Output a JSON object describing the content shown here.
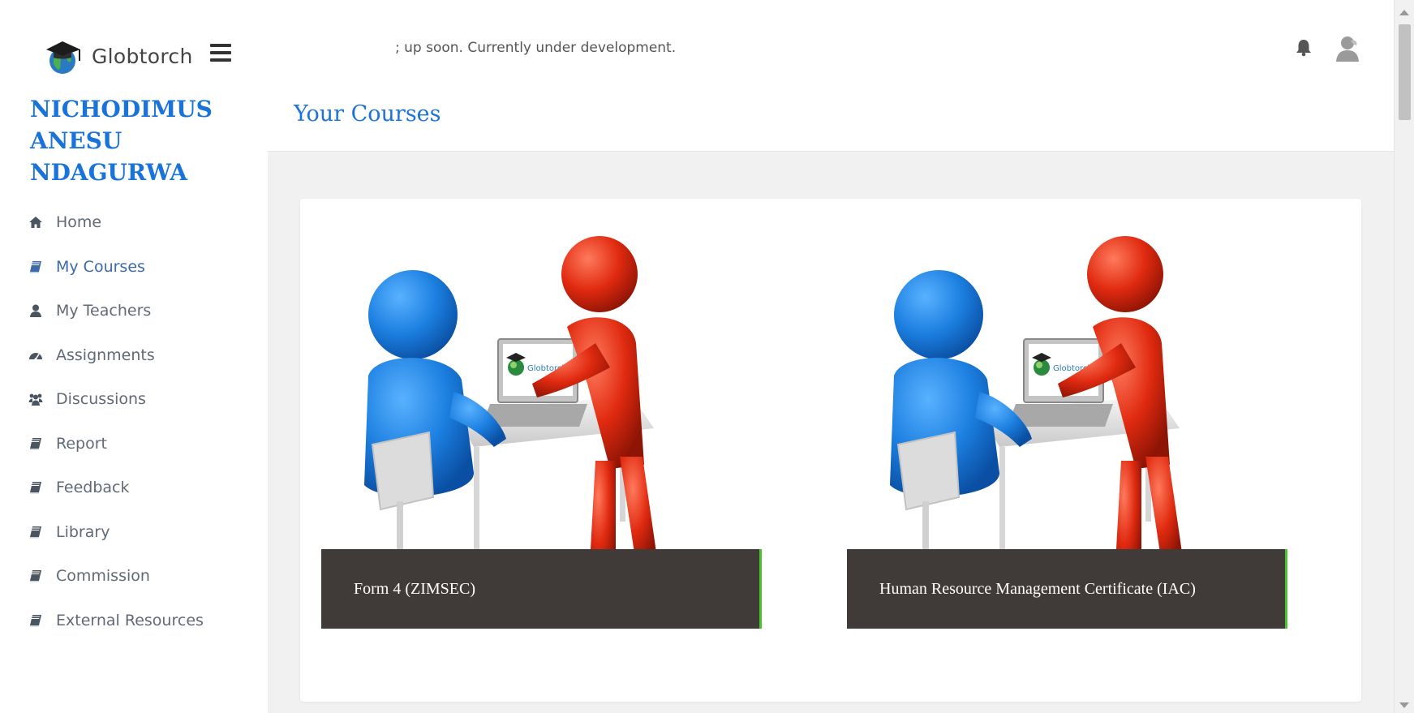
{
  "header": {
    "brand": "Globtorch",
    "ticker": "; up soon. Currently under development.",
    "icons": {
      "menu": "hamburger-icon",
      "notifications": "bell-icon",
      "user": "user-avatar-icon"
    }
  },
  "sidebar": {
    "student_name": "NICHODIMUS ANESU NDAGURWA",
    "items": [
      {
        "label": "Home",
        "icon": "home-icon"
      },
      {
        "label": "My Courses",
        "icon": "book-icon",
        "active": true
      },
      {
        "label": "My Teachers",
        "icon": "user-icon"
      },
      {
        "label": "Assignments",
        "icon": "dashboard-icon"
      },
      {
        "label": "Discussions",
        "icon": "group-icon"
      },
      {
        "label": "Report",
        "icon": "book-icon"
      },
      {
        "label": "Feedback",
        "icon": "book-icon"
      },
      {
        "label": "Library",
        "icon": "book-icon"
      },
      {
        "label": "Commission",
        "icon": "book-icon"
      },
      {
        "label": "External Resources",
        "icon": "book-icon"
      }
    ]
  },
  "main": {
    "title": "Your Courses",
    "courses": [
      {
        "name": "Form 4 (ZIMSEC)",
        "image_logo": "Globtorch"
      },
      {
        "name": "Human Resource Management Certificate (IAC)",
        "image_logo": "Globtorch"
      }
    ]
  },
  "colors": {
    "accent_blue": "#1a73d9",
    "label_bg": "#403b38",
    "label_border": "#45c42c",
    "figure_blue": "#1c7fe0",
    "figure_red": "#e02a10"
  }
}
